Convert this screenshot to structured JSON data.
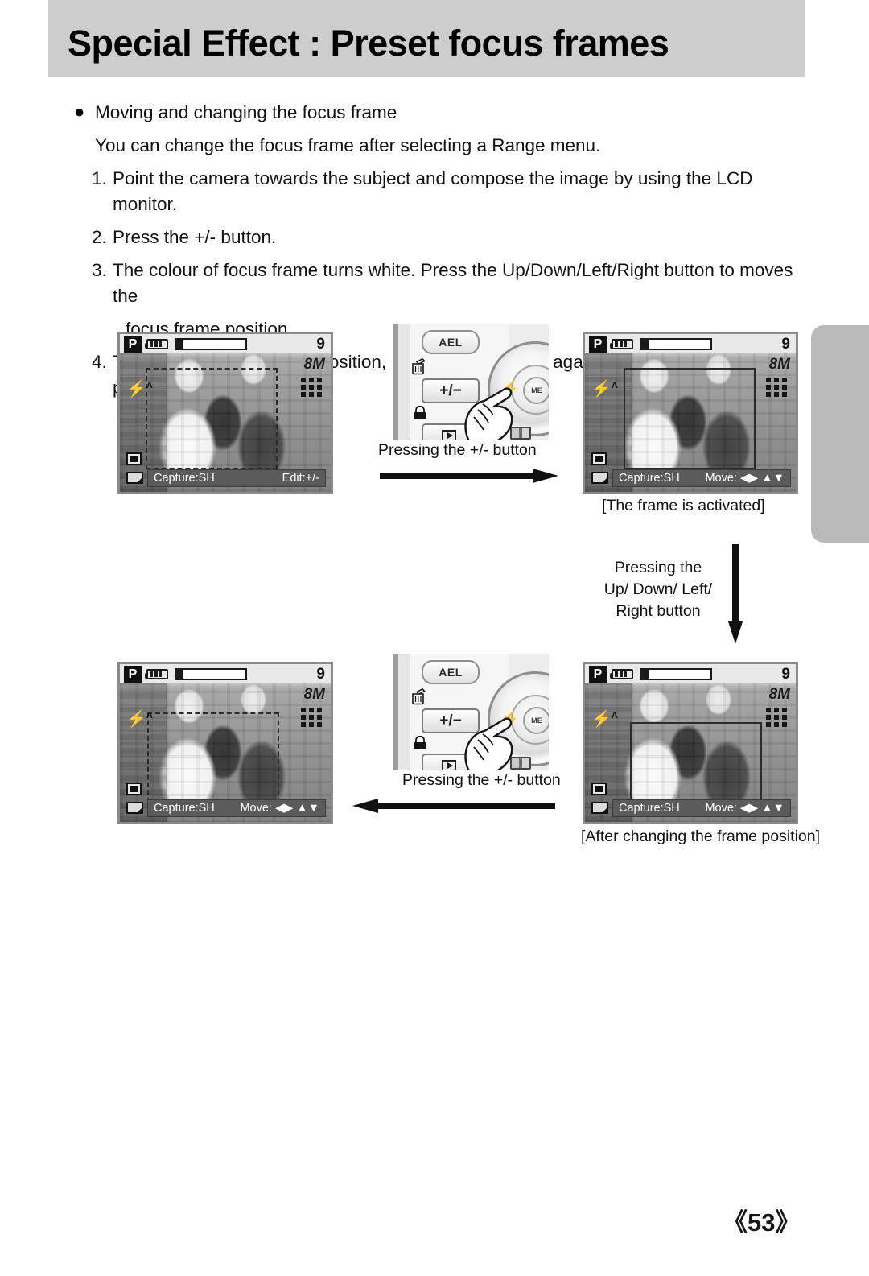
{
  "header": {
    "title": "Special Effect : Preset focus frames",
    "band_color": "#cdcdcd"
  },
  "body": {
    "bullet_glyph": "●",
    "bullet_heading": "Moving and changing the focus frame",
    "subheading": "You can change the focus frame after selecting a Range menu.",
    "steps": [
      {
        "num": "1.",
        "text": "Point the camera towards the subject and compose the image by using the LCD monitor."
      },
      {
        "num": "2.",
        "text": "Press the +/- button."
      },
      {
        "num": "3.",
        "text": "The colour of focus frame turns white. Press the Up/Down/Left/Right button to moves the"
      },
      {
        "num": "",
        "text": "focus frame position."
      },
      {
        "num": "4.",
        "text": "To select the focus frame position, press the +/- button again and you can take a picture."
      }
    ]
  },
  "lcd_screens": [
    {
      "id": "lcd-before",
      "mode": "P",
      "shots_remaining": "9",
      "resolution": "8M",
      "flash": "⚡",
      "flash_mode": "A",
      "status_left": "Capture:SH",
      "status_right": "Edit:+/-",
      "frame_style": "dashed"
    },
    {
      "id": "lcd-activated",
      "mode": "P",
      "shots_remaining": "9",
      "resolution": "8M",
      "flash": "⚡",
      "flash_mode": "A",
      "status_left": "Capture:SH",
      "status_right": "Move: ◀▶ ▲▼",
      "frame_style": "solid"
    },
    {
      "id": "lcd-after-confirm",
      "mode": "P",
      "shots_remaining": "9",
      "resolution": "8M",
      "flash": "⚡",
      "flash_mode": "A",
      "status_left": "Capture:SH",
      "status_right": "Move: ◀▶ ▲▼",
      "frame_style": "dashed"
    },
    {
      "id": "lcd-moved",
      "mode": "P",
      "shots_remaining": "9",
      "resolution": "8M",
      "flash": "⚡",
      "flash_mode": "A",
      "status_left": "Capture:SH",
      "status_right": "Move: ◀▶ ▲▼",
      "frame_style": "solid"
    }
  ],
  "camera_diagrams": {
    "ael_label": "AEL",
    "plusminus_label": "+/−",
    "menu_label": "ME"
  },
  "captions": {
    "press_plusminus_top": "Pressing the +/- button",
    "press_plusminus_bottom": "Pressing the +/- button",
    "frame_activated": "[The frame is activated]",
    "after_changing": "[After changing the frame position]",
    "updown_line1": "Pressing the",
    "updown_line2": "Up/ Down/ Left/",
    "updown_line3": "Right button"
  },
  "footer": {
    "page_number": "《53》"
  }
}
